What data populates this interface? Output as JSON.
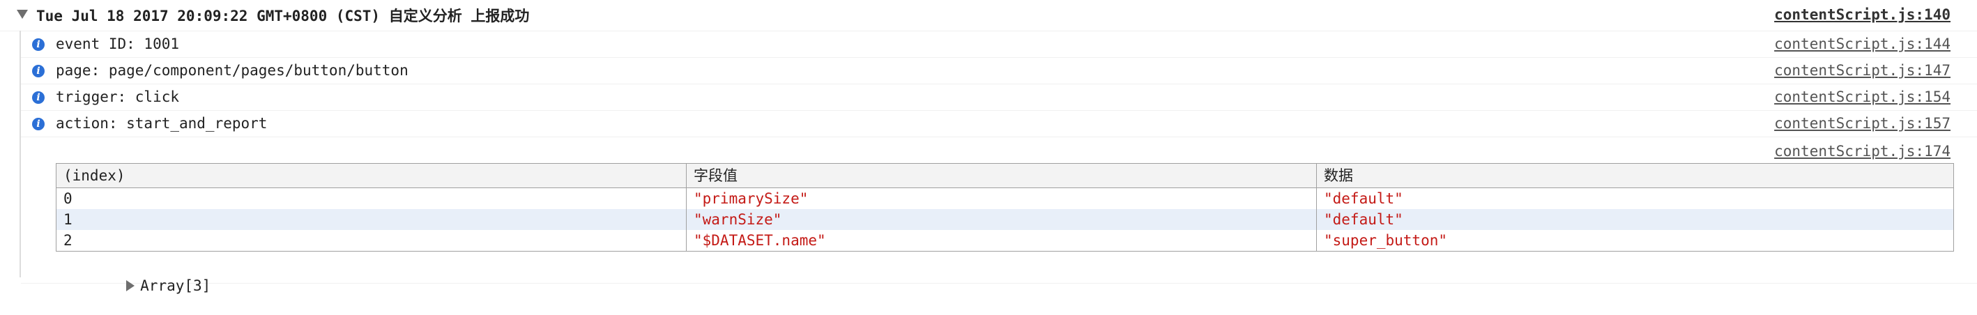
{
  "group": {
    "title": "Tue Jul 18 2017 20:09:22 GMT+0800 (CST) 自定义分析 上报成功",
    "source": "contentScript.js:140"
  },
  "logs": [
    {
      "text": "event ID: 1001",
      "source": "contentScript.js:144",
      "icon": "info-icon"
    },
    {
      "text": "page: page/component/pages/button/button",
      "source": "contentScript.js:147",
      "icon": "info-icon"
    },
    {
      "text": "trigger: click",
      "source": "contentScript.js:154",
      "icon": "info-icon"
    },
    {
      "text": "action: start_and_report",
      "source": "contentScript.js:157",
      "icon": "info-icon"
    }
  ],
  "table_entry": {
    "source": "contentScript.js:174",
    "columns": [
      "(index)",
      "字段值",
      "数据"
    ],
    "rows": [
      [
        "0",
        "\"primarySize\"",
        "\"default\""
      ],
      [
        "1",
        "\"warnSize\"",
        "\"default\""
      ],
      [
        "2",
        "\"$DATASET.name\"",
        "\"super_button\""
      ]
    ],
    "array_label": "Array[3]"
  },
  "colors": {
    "string_value": "#c41a16",
    "info_icon": "#2b6fd6",
    "highlight_row": "#e8eff9"
  }
}
